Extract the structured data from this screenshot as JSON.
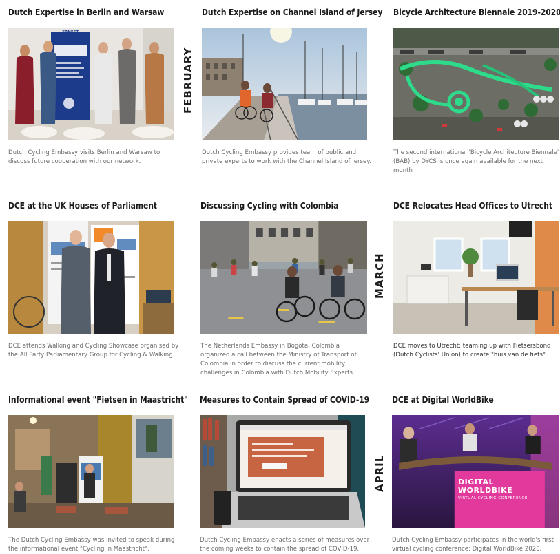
{
  "months": {
    "february": "FEBRUARY",
    "march": "MARCH",
    "april": "APRIL"
  },
  "cards": [
    {
      "title": "Dutch Expertise in Berlin and Warsaw",
      "description": "Dutch Cycling Embassy visits Berlin and Warsaw to discuss future cooperation with our network.",
      "banner_text": "ERNEST-REUTER-PLATZ FÜR RAD"
    },
    {
      "title": "Dutch Expertise on Channel Island of Jersey",
      "description": "Dutch Cycling Embassy provides team of public and private experts to work with the Channel Island of Jersey."
    },
    {
      "title": "Bicycle Architecture Biennale 2019-2020",
      "description": "The second international 'Bicycle Architecture Biennale' (BAB) by DYCS is once again available for the next month"
    },
    {
      "title": "DCE at the UK Houses of Parliament",
      "description": "DCE attends Walking and Cycling Showcase organised by the All Party Parliamentary Group for Cycling & Walking."
    },
    {
      "title": "Discussing Cycling with Colombia",
      "description": "The Netherlands Embassy in Bogota, Colombia organized a call between the Ministry of Transport of Colombia in order to discuss the current mobility challenges in Colombia with Dutch Mobility Experts."
    },
    {
      "title": "DCE Relocates Head Offices to Utrecht",
      "description": "DCE moves to Utrecht; teaming up with Fietsersbond (Dutch Cyclists' Union) to create \"huis van de fiets\"."
    },
    {
      "title": "Informational event \"Fietsen in Maastricht\"",
      "description": "The Dutch Cycling Embassy was invited to speak during the informational event \"Cycling in Maastricht\"."
    },
    {
      "title": "Measures to Contain Spread of COVID-19",
      "description": "Dutch Cycling Embassy enacts a series of measures over the coming weeks to contain the spread of COVID-19."
    },
    {
      "title": "DCE at Digital WorldBike",
      "description": "Dutch Cycling Embassy participates in the world's first virtual cycling conference: Digital WorldBike 2020.",
      "banner_title": "DIGITAL WORLDBIKE",
      "banner_sub": "VIRTUAL CYCLING CONFERENCE"
    }
  ],
  "colors": {
    "title": "#1a1a1a",
    "description": "#6b6b6b",
    "worldbike_pink": "#d8238a"
  }
}
